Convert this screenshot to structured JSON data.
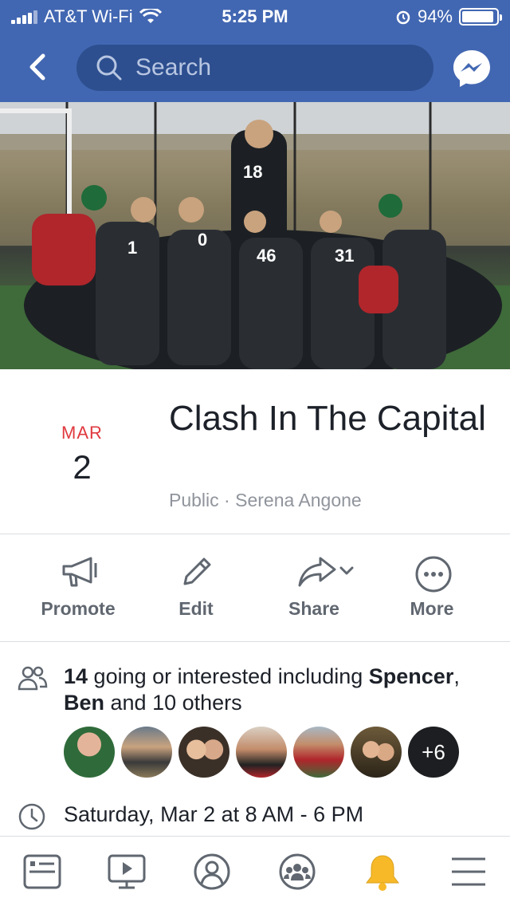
{
  "status_bar": {
    "carrier": "AT&T Wi-Fi",
    "time": "5:25 PM",
    "battery": "94%",
    "battery_level": 0.94
  },
  "nav": {
    "search_placeholder": "Search",
    "back_icon": "chevron-left-icon",
    "messenger_icon": "messenger-icon"
  },
  "event": {
    "month": "MAR",
    "day": "2",
    "title": "Clash In The Capital",
    "privacy": "Public",
    "separator": "·",
    "host": "Serena Angone"
  },
  "actions": [
    {
      "label": "Promote",
      "icon": "megaphone-icon"
    },
    {
      "label": "Edit",
      "icon": "pencil-icon"
    },
    {
      "label": "Share",
      "icon": "share-arrow-icon"
    },
    {
      "label": "More",
      "icon": "more-dots-icon"
    }
  ],
  "going": {
    "count": "14",
    "text1": " going or interested including ",
    "name1": "Spencer",
    "comma": ", ",
    "name2": "Ben",
    "text2": " and 10 others",
    "more_badge": "+6"
  },
  "when": {
    "text": "Saturday, Mar 2 at 8 AM - 6 PM"
  },
  "tabbar": [
    {
      "icon": "news-feed-icon"
    },
    {
      "icon": "watch-video-icon"
    },
    {
      "icon": "profile-icon"
    },
    {
      "icon": "groups-icon"
    },
    {
      "icon": "notifications-bell-icon"
    },
    {
      "icon": "menu-icon"
    }
  ],
  "colors": {
    "brand": "#4267b2",
    "date_red": "#e0393e",
    "bell_gold": "#f7b928"
  }
}
